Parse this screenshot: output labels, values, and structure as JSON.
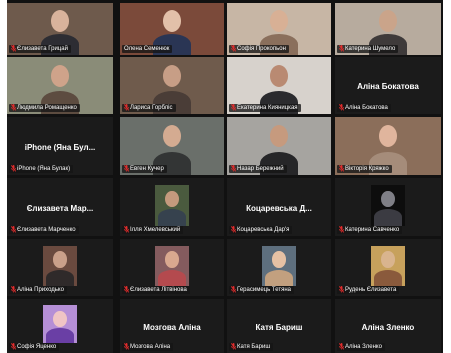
{
  "meeting": {
    "mic_muted_color": "#e02c2c",
    "active_speaker_color": "#c9e03a",
    "tiles": [
      {
        "label": "Єлизавета Грицай",
        "muted": true,
        "video": true,
        "bg": "#6e5a4c",
        "head": "#d9b39c",
        "body": "#2d2d33"
      },
      {
        "label": "Олена Семенюк",
        "muted": false,
        "video": true,
        "bg": "#7b4a3a",
        "head": "#e2c0a9",
        "body": "#2a3554"
      },
      {
        "label": "Софія Прокопьон",
        "muted": true,
        "video": true,
        "bg": "#c7b6a5",
        "head": "#d8b095",
        "body": "#8a6f5c"
      },
      {
        "label": "Катерина Шумело",
        "muted": true,
        "video": true,
        "bg": "#b7ab9e",
        "head": "#caa48a",
        "body": "#3e3a3a"
      },
      {
        "label": "Людмила Ромащенко",
        "muted": true,
        "video": true,
        "bg": "#8a8c78",
        "head": "#cfa38a",
        "body": "#5d4c40",
        "active": true
      },
      {
        "label": "Лариса Горбліс",
        "muted": true,
        "video": true,
        "bg": "#6f5b4c",
        "head": "#c79e86",
        "body": "#4a3d37"
      },
      {
        "label": "Екатерина Кияницкая",
        "muted": true,
        "video": true,
        "bg": "#d7d2cc",
        "head": "#b98a72",
        "body": "#2b2b2e"
      },
      {
        "label": "Аліна Бокатова",
        "name": "Аліна Бокатова",
        "muted": true,
        "video": false
      },
      {
        "label": "iPhone (Яна Булак)",
        "name": "iPhone (Яна Бул...",
        "muted": true,
        "video": false
      },
      {
        "label": "Евген Кучер",
        "muted": true,
        "video": true,
        "bg": "#6a6f6a",
        "head": "#d4ab91",
        "body": "#333535"
      },
      {
        "label": "Назар Бережний",
        "muted": true,
        "video": true,
        "bg": "#a6a4a0",
        "head": "#c69a7e",
        "body": "#262628"
      },
      {
        "label": "Вікторія Кряжко",
        "muted": true,
        "video": true,
        "bg": "#8b6e5a",
        "head": "#e0b59d",
        "body": "#a58c7a"
      },
      {
        "label": "Єлизавета Марченко",
        "name": "Єлизавета Мар...",
        "muted": true,
        "video": false
      },
      {
        "label": "Ілля Хмелевський",
        "muted": true,
        "video": true,
        "bg": "#4a5a3e",
        "head": "#c49a7d",
        "body": "#36424e",
        "small": true
      },
      {
        "label": "Коцаревська Дар'я",
        "name": "Коцаревська Д...",
        "muted": true,
        "video": false
      },
      {
        "label": "Катерина Савченко",
        "muted": true,
        "video": true,
        "bg": "#0d0d0d",
        "head": "#7f7f86",
        "body": "#3b3b42",
        "small": true
      },
      {
        "label": "Аліна Приходько",
        "muted": true,
        "video": true,
        "bg": "#6a4a3f",
        "head": "#caa08a",
        "body": "#2f2a2a",
        "small": true
      },
      {
        "label": "Єлизавета Літвінова",
        "muted": true,
        "video": true,
        "bg": "#845b5e",
        "head": "#d9a88f",
        "body": "#b44a4e",
        "small": true
      },
      {
        "label": "Герасимець Тетяна",
        "muted": true,
        "video": true,
        "bg": "#5e6f7e",
        "head": "#e6c1a4",
        "body": "#c2a07f",
        "small": true
      },
      {
        "label": "Рудень Єлизавета",
        "muted": true,
        "video": true,
        "bg": "#c7a15c",
        "head": "#d9b48e",
        "body": "#8a5a3c",
        "small": true
      },
      {
        "label": "Софія Яценко",
        "muted": true,
        "video": true,
        "bg": "#b58fd6",
        "head": "#f0c5c5",
        "body": "#6a3fa5",
        "small": true
      },
      {
        "label": "Мозгова Аліна",
        "name": "Мозгова Аліна",
        "muted": true,
        "video": false
      },
      {
        "label": "Катя Бариш",
        "name": "Катя Бариш",
        "muted": true,
        "video": false
      },
      {
        "label": "Аліна Зленко",
        "name": "Аліна Зленко",
        "muted": true,
        "video": false
      }
    ]
  }
}
